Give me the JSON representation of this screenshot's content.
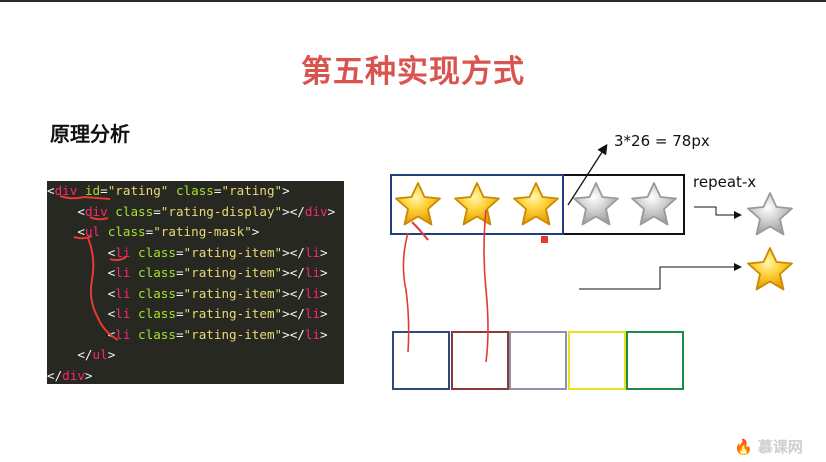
{
  "slide": {
    "title": "第五种实现方式",
    "subtitle": "原理分析",
    "formula": "3*26 = 78px",
    "repeat_label": "repeat-x",
    "watermark": "慕课网"
  },
  "code": {
    "lines": [
      {
        "indent": "",
        "parts": [
          [
            "punc",
            "<"
          ],
          [
            "tag",
            "div"
          ],
          [
            "punc",
            " "
          ],
          [
            "attr",
            "id"
          ],
          [
            "punc",
            "="
          ],
          [
            "str",
            "\"rating\""
          ],
          [
            "punc",
            " "
          ],
          [
            "attr",
            "class"
          ],
          [
            "punc",
            "="
          ],
          [
            "str",
            "\"rating\""
          ],
          [
            "punc",
            ">"
          ]
        ]
      },
      {
        "indent": "    ",
        "parts": [
          [
            "punc",
            "<"
          ],
          [
            "tag",
            "div"
          ],
          [
            "punc",
            " "
          ],
          [
            "attr",
            "class"
          ],
          [
            "punc",
            "="
          ],
          [
            "str",
            "\"rating-display\""
          ],
          [
            "punc",
            "></"
          ],
          [
            "tag",
            "div"
          ],
          [
            "punc",
            ">"
          ]
        ]
      },
      {
        "indent": "    ",
        "parts": [
          [
            "punc",
            "<"
          ],
          [
            "tag",
            "ul"
          ],
          [
            "punc",
            " "
          ],
          [
            "attr",
            "class"
          ],
          [
            "punc",
            "="
          ],
          [
            "str",
            "\"rating-mask\""
          ],
          [
            "punc",
            ">"
          ]
        ]
      },
      {
        "indent": "        ",
        "parts": [
          [
            "punc",
            "<"
          ],
          [
            "tag",
            "li"
          ],
          [
            "punc",
            " "
          ],
          [
            "attr",
            "class"
          ],
          [
            "punc",
            "="
          ],
          [
            "str",
            "\"rating-item\""
          ],
          [
            "punc",
            "></"
          ],
          [
            "tag",
            "li"
          ],
          [
            "punc",
            ">"
          ]
        ]
      },
      {
        "indent": "        ",
        "parts": [
          [
            "punc",
            "<"
          ],
          [
            "tag",
            "li"
          ],
          [
            "punc",
            " "
          ],
          [
            "attr",
            "class"
          ],
          [
            "punc",
            "="
          ],
          [
            "str",
            "\"rating-item\""
          ],
          [
            "punc",
            "></"
          ],
          [
            "tag",
            "li"
          ],
          [
            "punc",
            ">"
          ]
        ]
      },
      {
        "indent": "        ",
        "parts": [
          [
            "punc",
            "<"
          ],
          [
            "tag",
            "li"
          ],
          [
            "punc",
            " "
          ],
          [
            "attr",
            "class"
          ],
          [
            "punc",
            "="
          ],
          [
            "str",
            "\"rating-item\""
          ],
          [
            "punc",
            "></"
          ],
          [
            "tag",
            "li"
          ],
          [
            "punc",
            ">"
          ]
        ]
      },
      {
        "indent": "        ",
        "parts": [
          [
            "punc",
            "<"
          ],
          [
            "tag",
            "li"
          ],
          [
            "punc",
            " "
          ],
          [
            "attr",
            "class"
          ],
          [
            "punc",
            "="
          ],
          [
            "str",
            "\"rating-item\""
          ],
          [
            "punc",
            "></"
          ],
          [
            "tag",
            "li"
          ],
          [
            "punc",
            ">"
          ]
        ]
      },
      {
        "indent": "        ",
        "parts": [
          [
            "punc",
            "<"
          ],
          [
            "tag",
            "li"
          ],
          [
            "punc",
            " "
          ],
          [
            "attr",
            "class"
          ],
          [
            "punc",
            "="
          ],
          [
            "str",
            "\"rating-item\""
          ],
          [
            "punc",
            "></"
          ],
          [
            "tag",
            "li"
          ],
          [
            "punc",
            ">"
          ]
        ]
      },
      {
        "indent": "    ",
        "parts": [
          [
            "punc",
            "</"
          ],
          [
            "tag",
            "ul"
          ],
          [
            "punc",
            ">"
          ]
        ]
      },
      {
        "indent": "",
        "parts": [
          [
            "punc",
            "</"
          ],
          [
            "tag",
            "div"
          ],
          [
            "punc",
            ">"
          ]
        ]
      }
    ]
  },
  "diagram": {
    "sprite_stars": [
      "gold",
      "gold",
      "gold",
      "gray",
      "gray"
    ],
    "slot_colors": [
      "#2d4a7a",
      "#8b3a3a",
      "#8a93a8",
      "#e8e21a",
      "#1e8a4a"
    ],
    "colors": {
      "title": "#d9534f",
      "code_bg": "#272822",
      "annotation": "#e53935",
      "selection": "#1f3f7f"
    }
  }
}
